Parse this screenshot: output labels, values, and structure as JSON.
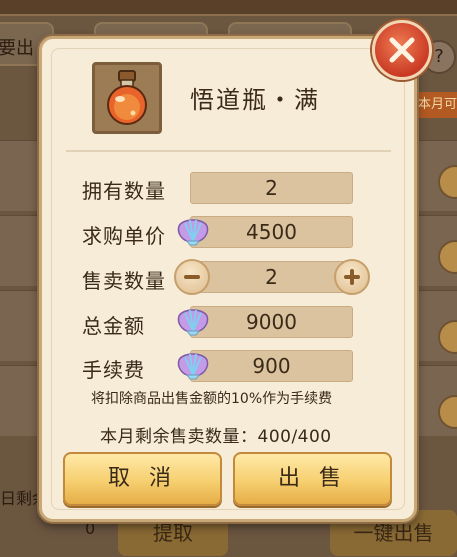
{
  "background": {
    "tab_left_label": "要出",
    "help_label": "?",
    "right_label": "本月可",
    "bottom_label": "日剩余",
    "bottom_value": "0",
    "withdraw_label": "提取",
    "sell_all_label": "一键出售"
  },
  "dialog": {
    "item_name": "悟道瓶・满",
    "item_icon": "bottle-icon",
    "rows": [
      {
        "label": "拥有数量",
        "value": "2"
      },
      {
        "label": "求购单价",
        "value": "4500",
        "currency_icon": "shell-icon"
      },
      {
        "label": "售卖数量",
        "value": "2"
      },
      {
        "label": "总金额",
        "value": "9000",
        "currency_icon": "shell-icon"
      },
      {
        "label": "手续费",
        "value": "900",
        "currency_icon": "shell-icon"
      }
    ],
    "notice": "将扣除商品出售金额的10%作为手续费",
    "monthly_limit": "本月剩余售卖数量：400/400",
    "cancel_label": "取 消",
    "sell_label": "出 售"
  },
  "colors": {
    "panel_bg": "#f6ecd8",
    "field_bg": "#dcc3a0",
    "button_gold": "#f6cf70",
    "close_red": "#c93a24"
  }
}
